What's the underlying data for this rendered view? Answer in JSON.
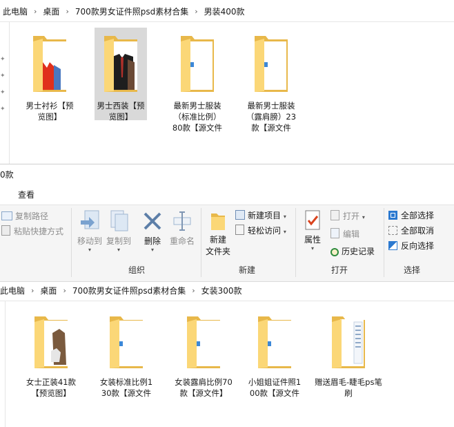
{
  "top_window": {
    "breadcrumb": [
      "此电脑",
      "桌面",
      "700款男女证件照psd素材合集",
      "男装400款"
    ],
    "folders": [
      {
        "label": "男士衬衫【预览图】",
        "thumb": "shirt-preview",
        "selected": false
      },
      {
        "label": "男士西装【预览图】",
        "thumb": "suit-preview",
        "selected": true
      },
      {
        "label": "最新男士服装（标准比例）80款【源文件",
        "thumb": "psd-file",
        "selected": false
      },
      {
        "label": "最新男士服装（露肩膀）23款【源文件",
        "thumb": "psd-file",
        "selected": false
      }
    ]
  },
  "bottom_window": {
    "title_fragment": "0款",
    "ribbon_tab": "查看",
    "clipboard_items": [
      "复制路径",
      "粘贴快捷方式"
    ],
    "organize": {
      "move_to": "移动到",
      "copy_to": "复制到",
      "delete": "删除",
      "rename": "重命名",
      "group": "组织"
    },
    "new": {
      "new_folder_line1": "新建",
      "new_folder_line2": "文件夹",
      "new_item": "新建项目",
      "easy_access": "轻松访问",
      "group": "新建"
    },
    "open": {
      "properties": "属性",
      "open": "打开",
      "edit": "编辑",
      "history": "历史记录",
      "group": "打开"
    },
    "select": {
      "select_all": "全部选择",
      "select_none": "全部取消",
      "invert": "反向选择",
      "group": "选择"
    },
    "breadcrumb": [
      "此电脑",
      "桌面",
      "700款男女证件照psd素材合集",
      "女装300款"
    ],
    "folders": [
      {
        "label": "女士正装41款【预览图】",
        "thumb": "blouse-preview"
      },
      {
        "label": "女装标准比例130款【源文件",
        "thumb": "psd-file"
      },
      {
        "label": "女装露肩比例70款【源文件】",
        "thumb": "psd-file"
      },
      {
        "label": "小姐姐证件照100款【源文件",
        "thumb": "psd-file"
      },
      {
        "label": "赠送眉毛-睫毛ps笔刷",
        "thumb": "brush-files"
      }
    ]
  },
  "colors": {
    "folder_back": "#E8B84A",
    "folder_front": "#FBD777",
    "selection": "#D9D9D9",
    "ribbon_bg": "#F5F5F5",
    "accent_blue": "#2B79D0"
  }
}
